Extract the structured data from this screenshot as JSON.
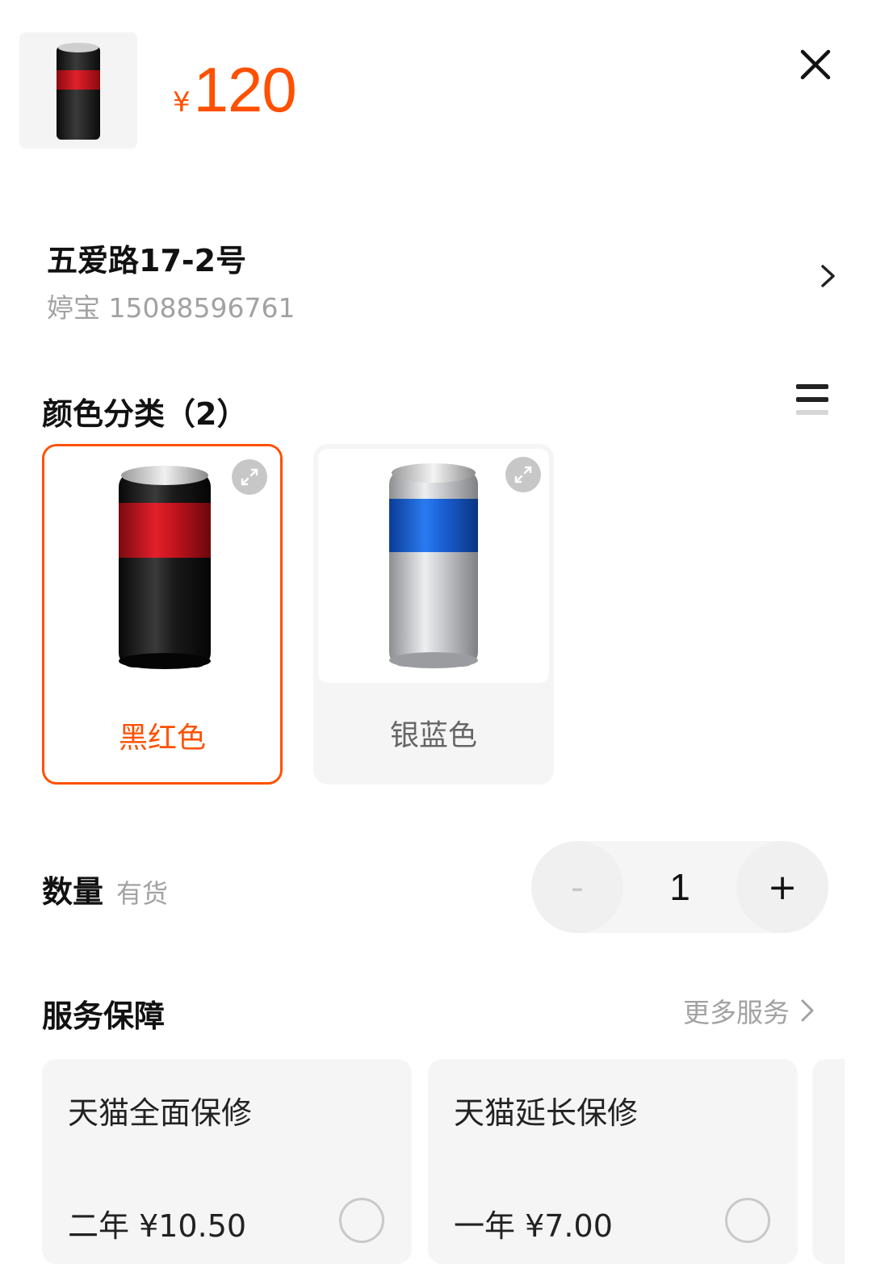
{
  "header": {
    "currency_symbol": "¥",
    "price": "120",
    "close_icon": "close-icon"
  },
  "address": {
    "line": "五爱路17-2号",
    "contact": "婷宝 15088596761"
  },
  "color_section": {
    "title": "颜色分类（2）",
    "options": [
      {
        "label": "黑红色",
        "selected": true,
        "body_color": "#1a1a1a",
        "band_color": "#d0101c"
      },
      {
        "label": "银蓝色",
        "selected": false,
        "body_color": "#bfc1c4",
        "band_color": "#1560d8"
      }
    ]
  },
  "quantity": {
    "title": "数量",
    "stock": "有货",
    "minus": "-",
    "value": "1",
    "plus": "+"
  },
  "service": {
    "title": "服务保障",
    "more": "更多服务",
    "cards": [
      {
        "name": "天猫全面保修",
        "price": "二年 ¥10.50"
      },
      {
        "name": "天猫延长保修",
        "price": "一年 ¥7.00"
      }
    ]
  },
  "colors": {
    "accent": "#ff5000",
    "muted_text": "#a2a2a2",
    "card_bg": "#f5f5f5"
  }
}
